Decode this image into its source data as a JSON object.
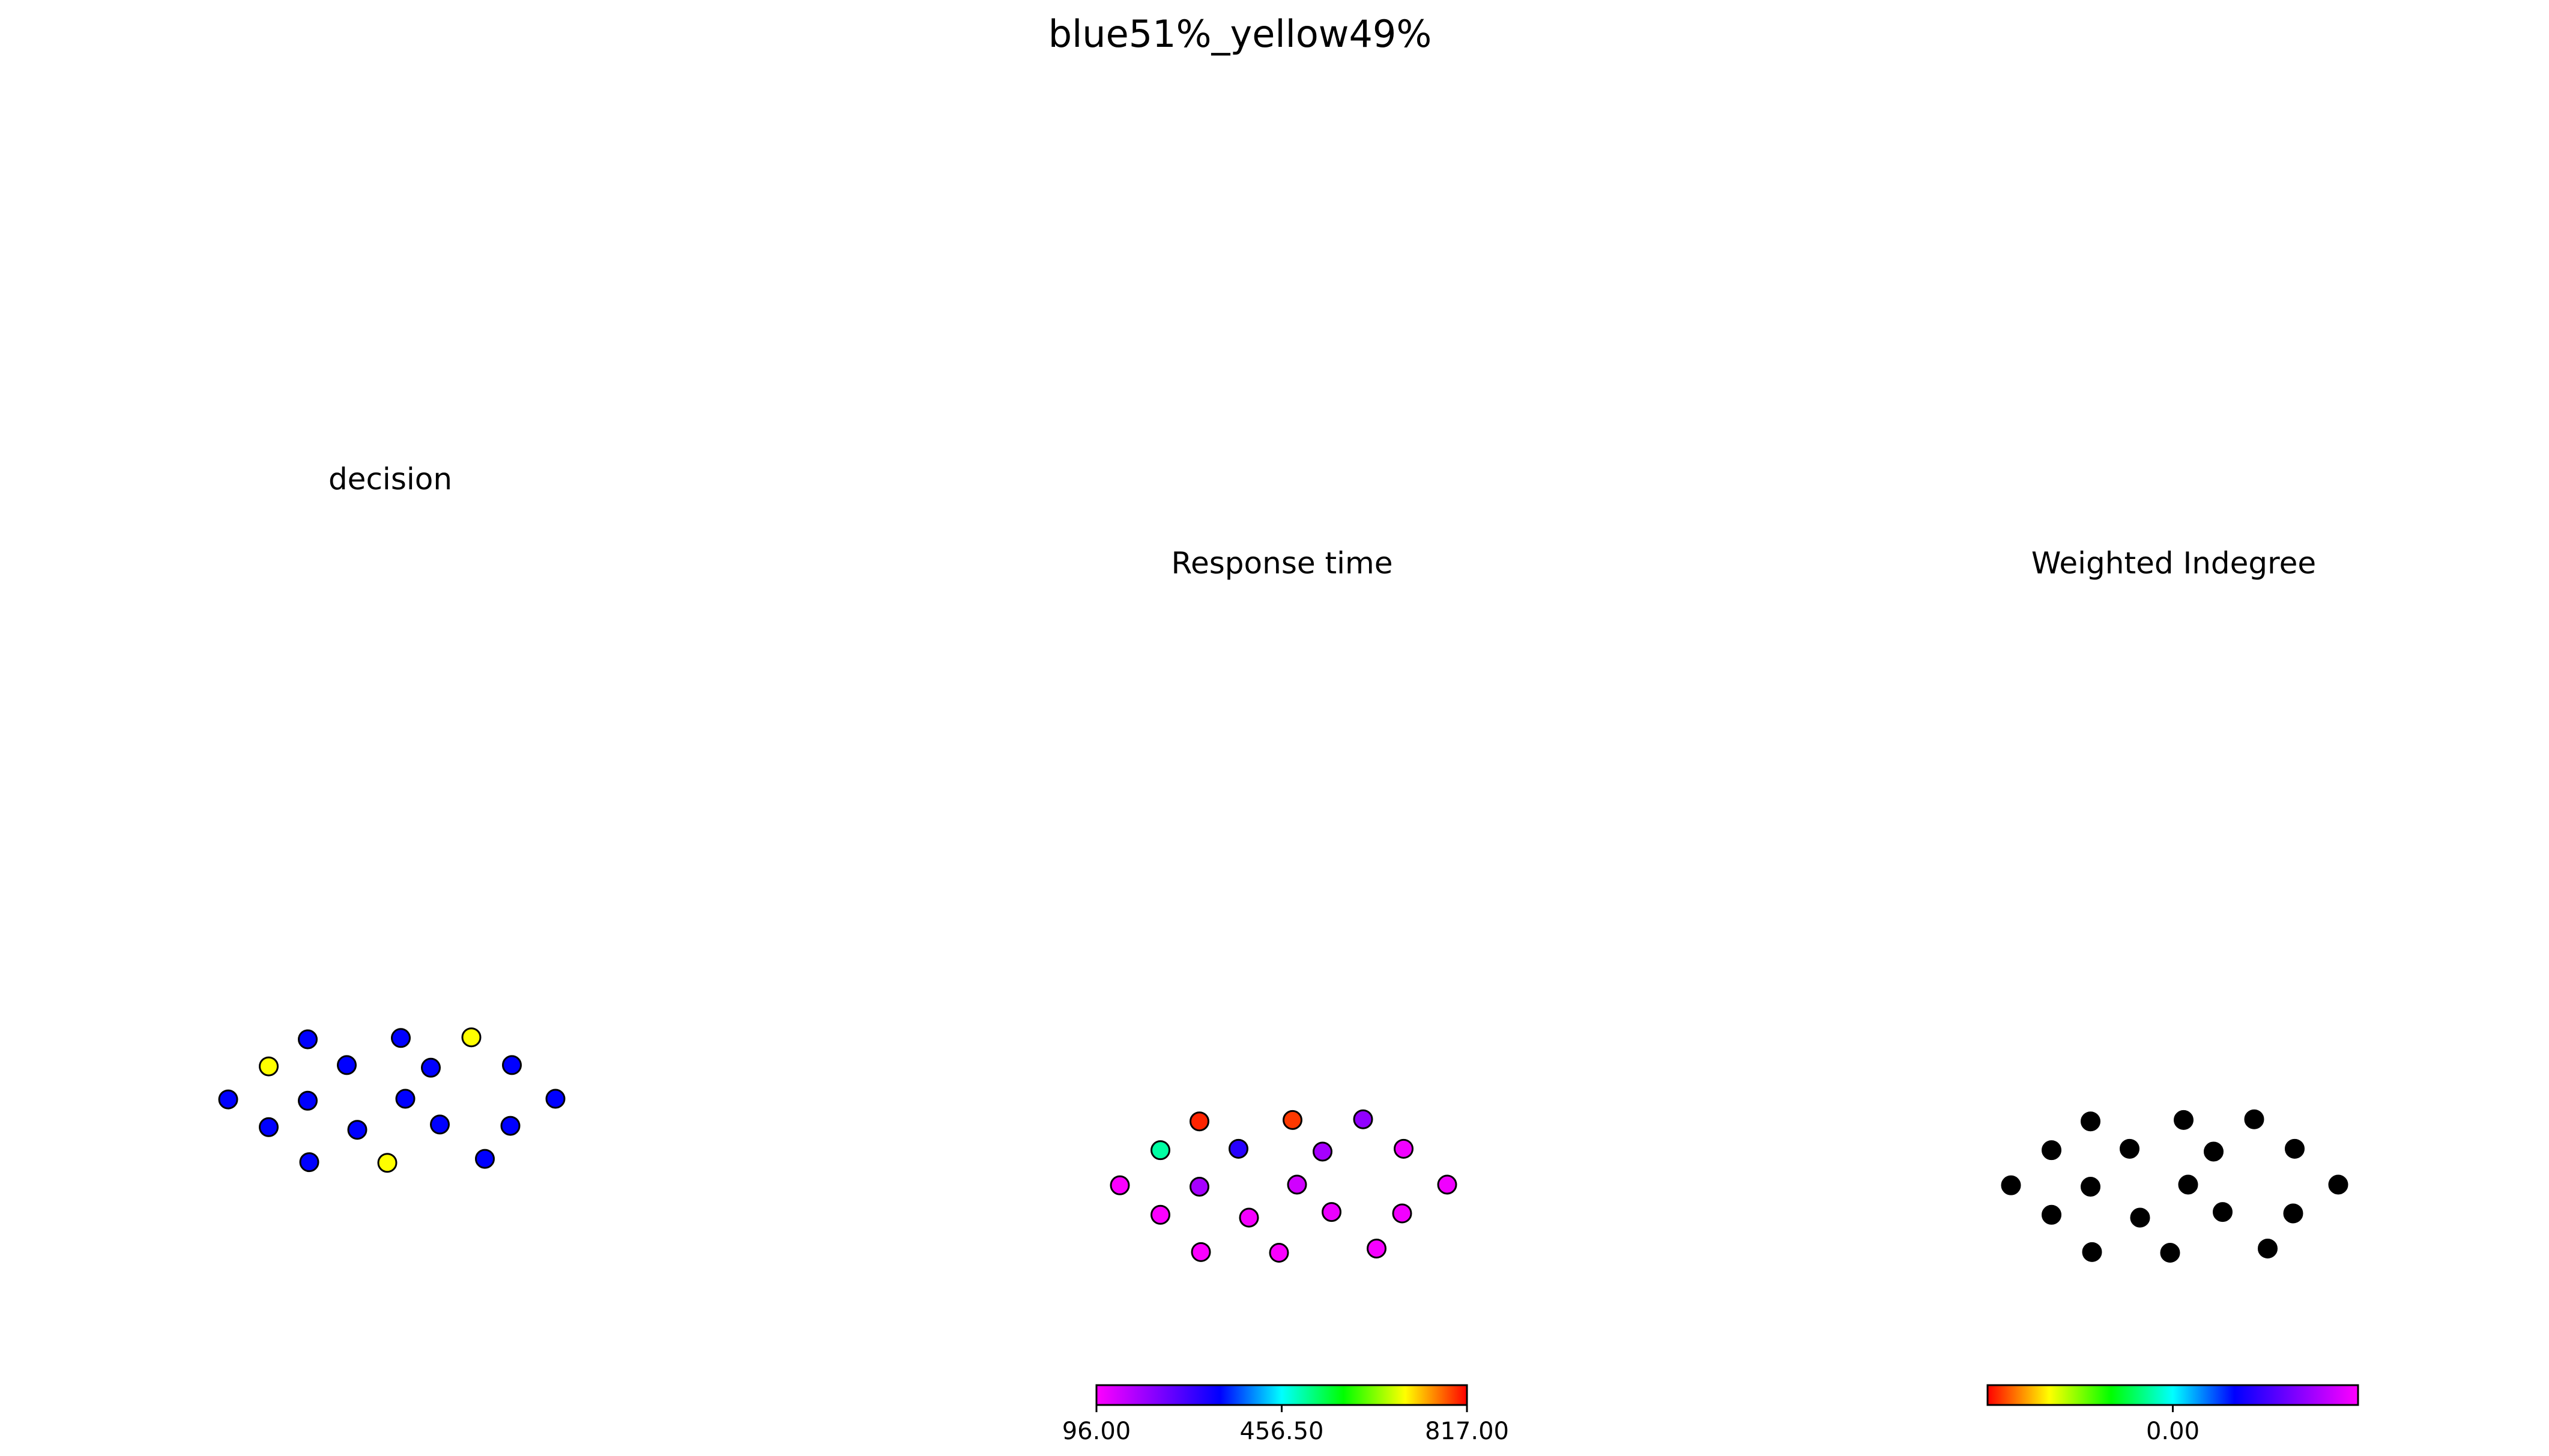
{
  "figure_title": "blue51%_yellow49%",
  "chart_data": [
    {
      "type": "scatter",
      "title": "decision",
      "node_fill": [
        "blue",
        "blue",
        "yellow",
        "yellow",
        "blue",
        "blue",
        "blue",
        "blue",
        "blue",
        "blue",
        "blue",
        "blue",
        "blue",
        "blue",
        "blue",
        "blue",
        "yellow",
        "blue",
        "blue"
      ],
      "x": [
        -0.57,
        0.05,
        0.52,
        -0.83,
        -0.31,
        0.25,
        0.79,
        -1.1,
        -0.57,
        0.08,
        1.08,
        -0.83,
        -0.24,
        0.31,
        0.78,
        -0.56,
        -0.04,
        0.61
      ],
      "y": [
        0.9,
        0.92,
        0.93,
        0.49,
        0.51,
        0.47,
        0.51,
        -0.01,
        -0.03,
        0.0,
        0.0,
        -0.43,
        -0.47,
        -0.39,
        -0.41,
        -0.96,
        -0.97,
        -0.91
      ]
    },
    {
      "type": "scatter",
      "title": "Response time",
      "colorbar": {
        "min": 96.0,
        "max": 817.0,
        "ticks": [
          "96.00",
          "456.50",
          "817.00"
        ],
        "colormap": [
          "#ff00ff",
          "#8000ff",
          "#0000ff",
          "#00ffff",
          "#00ff00",
          "#ffff00",
          "#ff0000"
        ]
      },
      "x": [
        -0.57,
        0.05,
        0.52,
        -0.83,
        -0.31,
        0.25,
        0.79,
        -1.1,
        -0.57,
        0.08,
        1.08,
        -0.83,
        -0.24,
        0.31,
        0.78,
        -0.56,
        -0.04,
        0.61
      ],
      "y": [
        0.9,
        0.92,
        0.93,
        0.49,
        0.51,
        0.47,
        0.51,
        -0.01,
        -0.03,
        0.0,
        0.0,
        -0.43,
        -0.47,
        -0.39,
        -0.41,
        -0.96,
        -0.97,
        -0.91
      ],
      "values": [
        800,
        790,
        200,
        500,
        300,
        180,
        110,
        100,
        180,
        140,
        110,
        100,
        105,
        115,
        108,
        100,
        102,
        105
      ]
    },
    {
      "type": "scatter",
      "title": "Weighted Indegree",
      "colorbar": {
        "ticks": [
          "0.00"
        ],
        "colormap": [
          "#ff0000",
          "#ffff00",
          "#00ff00",
          "#00ffff",
          "#0000ff",
          "#8000ff",
          "#ff00ff"
        ]
      },
      "node_fill": "#000000",
      "x": [
        -0.57,
        0.05,
        0.52,
        -0.83,
        -0.31,
        0.25,
        0.79,
        -1.1,
        -0.57,
        0.08,
        1.08,
        -0.83,
        -0.24,
        0.31,
        0.78,
        -0.56,
        -0.04,
        0.61
      ],
      "y": [
        0.9,
        0.92,
        0.93,
        0.49,
        0.51,
        0.47,
        0.51,
        -0.01,
        -0.03,
        0.0,
        0.0,
        -0.43,
        -0.47,
        -0.39,
        -0.41,
        -0.96,
        -0.97,
        -0.91
      ],
      "values": [
        0,
        0,
        0,
        0,
        0,
        0,
        0,
        0,
        0,
        0,
        0,
        0,
        0,
        0,
        0,
        0,
        0,
        0
      ]
    }
  ]
}
